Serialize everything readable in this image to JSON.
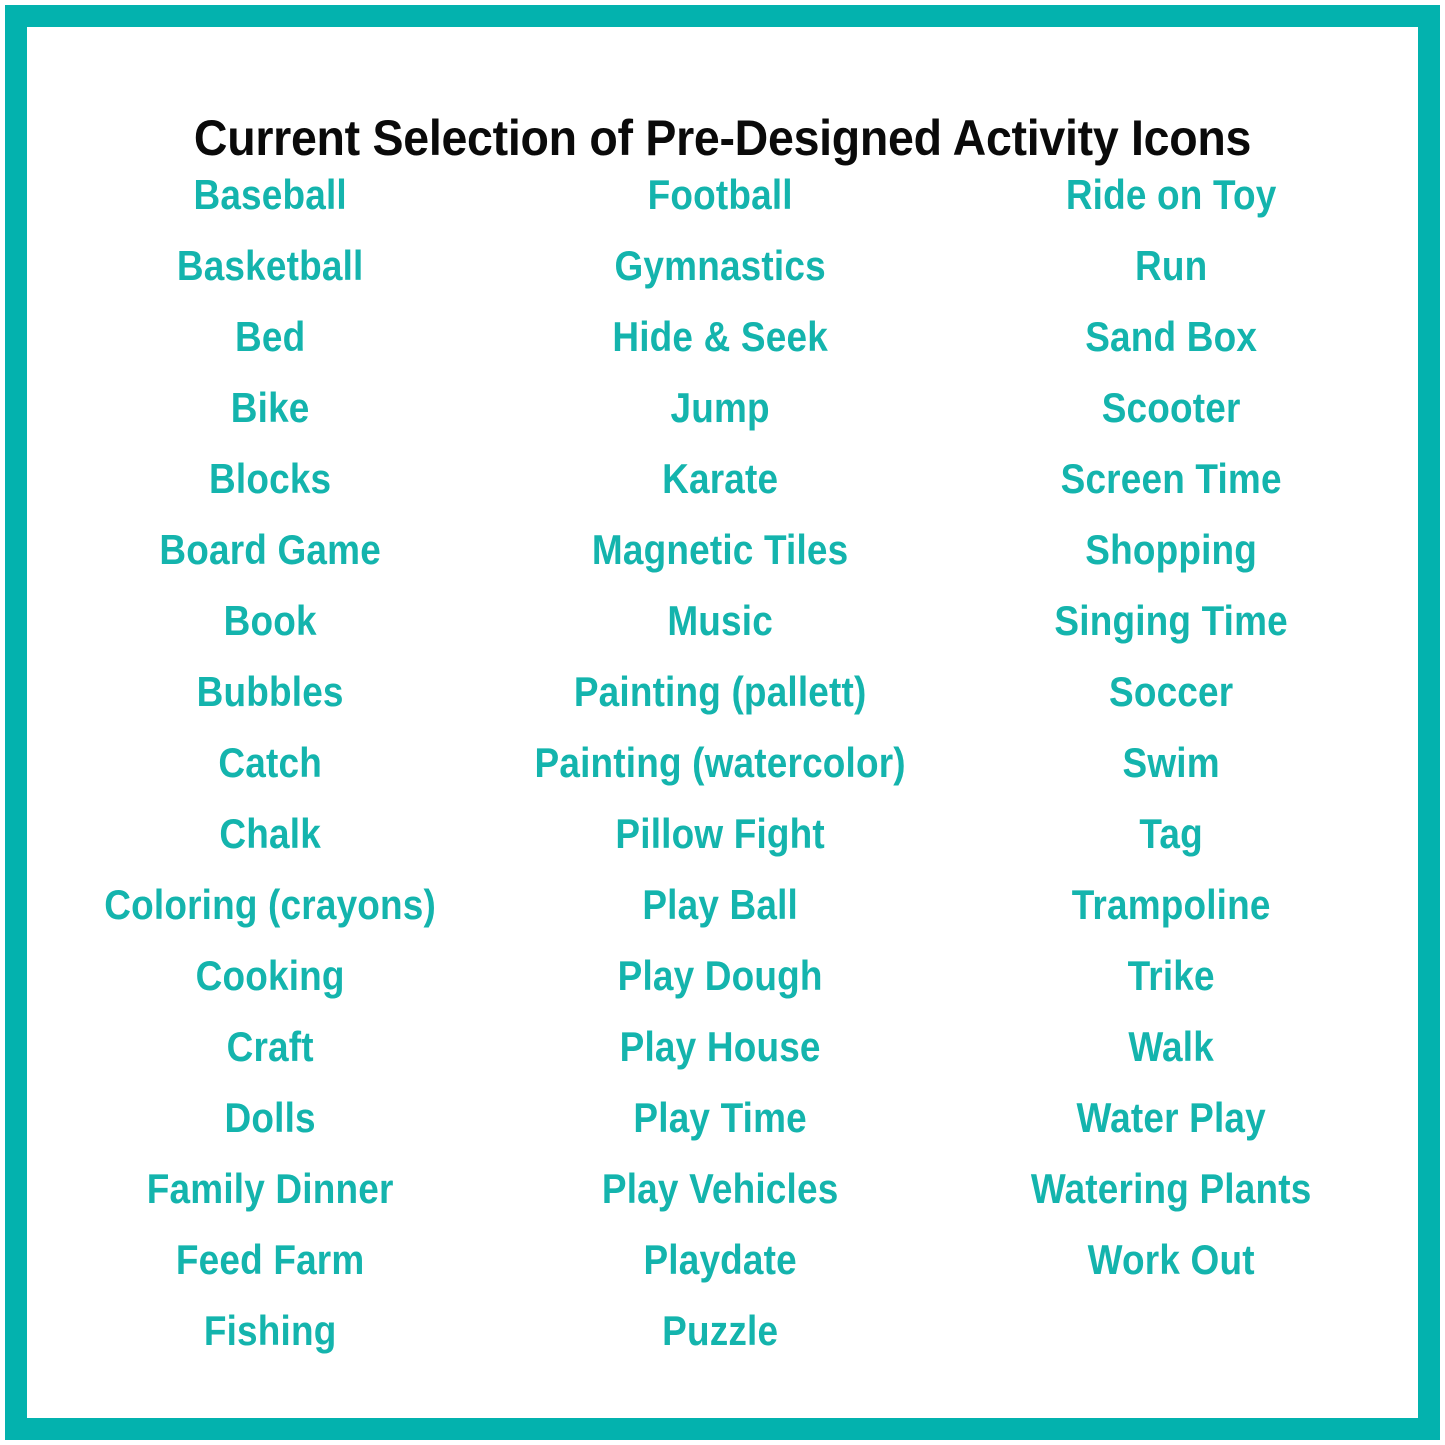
{
  "poster": {
    "title": "Current Selection of Pre-Designed Activity Icons",
    "border_color": "#03b2ae",
    "text_color": "#14b4ad",
    "title_color": "#0a0a0a",
    "background_color": "#ffffff"
  },
  "columns": [
    {
      "name": "column-1",
      "items": [
        "Baseball",
        "Basketball",
        "Bed",
        "Bike",
        "Blocks",
        "Board Game",
        "Book",
        "Bubbles",
        "Catch",
        "Chalk",
        "Coloring (crayons)",
        "Cooking",
        "Craft",
        "Dolls",
        "Family Dinner",
        "Feed Farm",
        "Fishing"
      ]
    },
    {
      "name": "column-2",
      "items": [
        "Football",
        "Gymnastics",
        "Hide & Seek",
        "Jump",
        "Karate",
        "Magnetic Tiles",
        "Music",
        "Painting (pallett)",
        "Painting (watercolor)",
        "Pillow Fight",
        "Play Ball",
        "Play Dough",
        "Play House",
        "Play Time",
        "Play Vehicles",
        "Playdate",
        "Puzzle"
      ]
    },
    {
      "name": "column-3",
      "items": [
        "Ride on Toy",
        "Run",
        "Sand Box",
        "Scooter",
        "Screen Time",
        "Shopping",
        "Singing Time",
        "Soccer",
        "Swim",
        "Tag",
        "Trampoline",
        "Trike",
        "Walk",
        "Water Play",
        "Watering Plants",
        "Work Out"
      ]
    }
  ]
}
